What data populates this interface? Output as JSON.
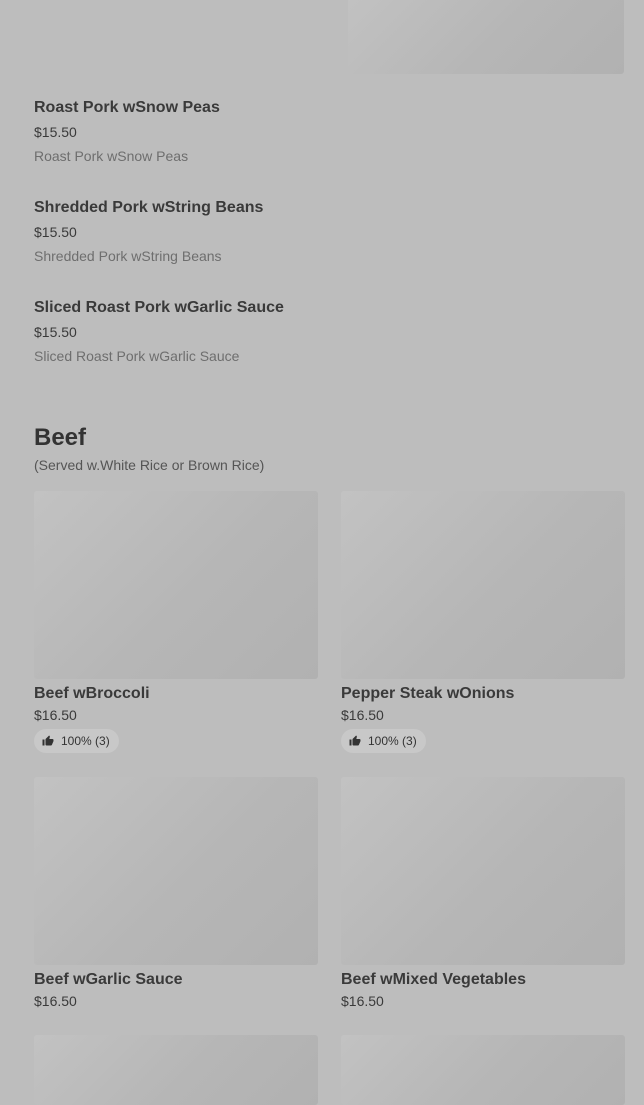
{
  "list_items": [
    {
      "name": "Roast Pork wSnow Peas",
      "price": "$15.50",
      "description": "Roast Pork wSnow Peas"
    },
    {
      "name": "Shredded Pork wString Beans",
      "price": "$15.50",
      "description": "Shredded Pork wString Beans"
    },
    {
      "name": "Sliced Roast Pork wGarlic Sauce",
      "price": "$15.50",
      "description": "Sliced Roast Pork wGarlic Sauce"
    }
  ],
  "section": {
    "title": "Beef",
    "subtitle": "(Served w.White Rice or Brown Rice)"
  },
  "cards": [
    {
      "name": "Beef wBroccoli",
      "price": "$16.50",
      "rating": "100% (3)"
    },
    {
      "name": "Pepper Steak wOnions",
      "price": "$16.50",
      "rating": "100% (3)"
    },
    {
      "name": "Beef wGarlic Sauce",
      "price": "$16.50"
    },
    {
      "name": "Beef wMixed Vegetables",
      "price": "$16.50"
    }
  ],
  "icons": {
    "rating_icon": "thumbs-up-icon"
  },
  "colors": {
    "overlay_background": "#bdbdbd",
    "placeholder": "#b6b6b6"
  }
}
